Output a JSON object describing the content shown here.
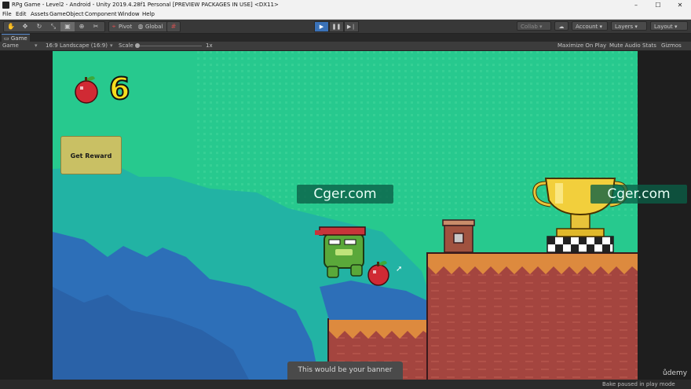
{
  "window": {
    "title": "RPg Game - Level2 - Android - Unity 2019.4.28f1 Personal [PREVIEW PACKAGES IN USE] <DX11>",
    "minimize": "–",
    "maximize": "☐",
    "close": "✕"
  },
  "menu": [
    "File",
    "Edit",
    "Assets",
    "GameObject",
    "Component",
    "Window",
    "Help"
  ],
  "toolbar": {
    "pivot_label": "Pivot",
    "global_label": "Global",
    "collab_label": "Collab ▾",
    "account_label": "Account",
    "layers_label": "Layers",
    "layout_label": "Layout"
  },
  "tab": {
    "label": "Game"
  },
  "game_header": {
    "display": "Game",
    "aspect": "16:9 Landscape (16:9)",
    "scale_label": "Scale",
    "scale_value": "1x",
    "maximize_on_play": "Maximize On Play",
    "mute_audio": "Mute Audio",
    "stats": "Stats",
    "gizmos": "Gizmos"
  },
  "hud": {
    "apple_count": "6",
    "reward_button": "Get Reward",
    "banner": "This would be your banner"
  },
  "watermarks": {
    "left": "Cger.com",
    "right": "Cger.com"
  },
  "status": {
    "message": "Bake paused in play mode",
    "brand": "ůdemy"
  },
  "colors": {
    "sky": "#27c98e",
    "water_dark": "#2d6fb8",
    "ground": "#a4453f",
    "grass": "#dd8a3e",
    "play_active": "#3a72b8"
  }
}
